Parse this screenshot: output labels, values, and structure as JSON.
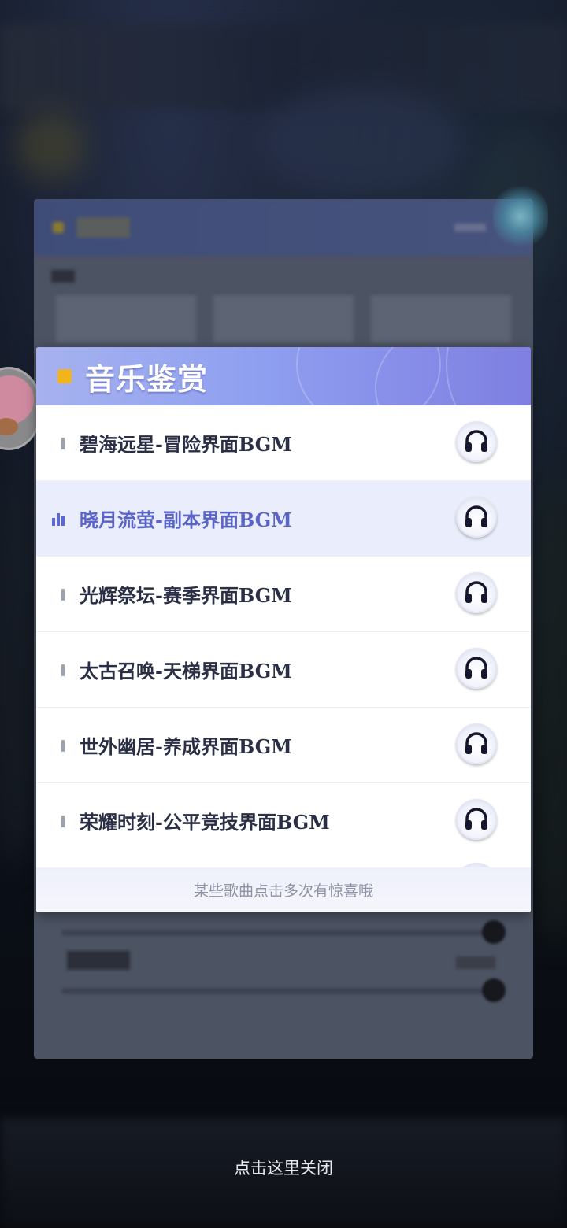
{
  "popup": {
    "title": "音乐鉴赏",
    "footer_hint": "某些歌曲点击多次有惊喜哦",
    "songs": [
      {
        "title": "碧海远星-冒险界面BGM",
        "playing": false
      },
      {
        "title": "晓月流萤-副本界面BGM",
        "playing": true
      },
      {
        "title": "光辉祭坛-赛季界面BGM",
        "playing": false
      },
      {
        "title": "太古召唤-天梯界面BGM",
        "playing": false
      },
      {
        "title": "世外幽居-养成界面BGM",
        "playing": false
      },
      {
        "title": "荣耀时刻-公平竞技界面BGM",
        "playing": false
      }
    ],
    "listen_icon": "headphones-icon"
  },
  "close_hint": "点击这里关闭",
  "colors": {
    "header_gradient_start": "#a6b2ef",
    "header_gradient_end": "#7f7fe1",
    "title_bullet": "#f2b41c",
    "active_row_bg": "#eaedfb",
    "active_text": "#5a64c8"
  }
}
